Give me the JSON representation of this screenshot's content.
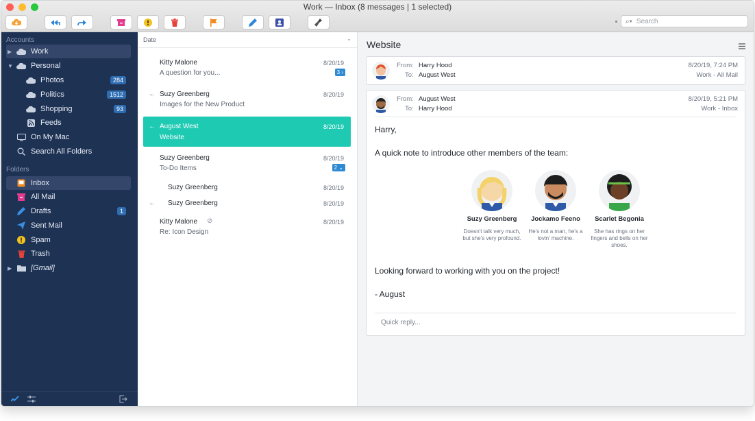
{
  "window": {
    "title": "Work — Inbox (8 messages | 1 selected)"
  },
  "toolbar": {
    "search_placeholder": "Search"
  },
  "sidebar": {
    "accounts_title": "Accounts",
    "folders_title": "Folders",
    "accounts": [
      {
        "label": "Work"
      },
      {
        "label": "Personal"
      },
      {
        "label": "Photos",
        "badge": "284"
      },
      {
        "label": "Politics",
        "badge": "1512"
      },
      {
        "label": "Shopping",
        "badge": "93"
      },
      {
        "label": "Feeds"
      },
      {
        "label": "On My Mac"
      },
      {
        "label": "Search All Folders"
      }
    ],
    "folders": [
      {
        "label": "Inbox"
      },
      {
        "label": "All Mail"
      },
      {
        "label": "Drafts",
        "badge": "1"
      },
      {
        "label": "Sent Mail"
      },
      {
        "label": "Spam"
      },
      {
        "label": "Trash"
      },
      {
        "label": "[Gmail]"
      }
    ]
  },
  "list": {
    "sort_label": "Date",
    "messages": [
      {
        "from": "Kitty Malone",
        "subject": "A question for you...",
        "date": "8/20/19",
        "count": "3"
      },
      {
        "from": "Suzy Greenberg",
        "subject": "Images for the New Product",
        "date": "8/20/19"
      },
      {
        "from": "August West",
        "subject": "Website",
        "date": "8/20/19"
      },
      {
        "from": "Suzy Greenberg",
        "subject": "To-Do Items",
        "date": "8/20/19",
        "count": "2"
      },
      {
        "from": "Suzy Greenberg",
        "date": "8/20/19"
      },
      {
        "from": "Suzy Greenberg",
        "date": "8/20/19"
      },
      {
        "from": "Kitty Malone",
        "subject": "Re: Icon Design",
        "date": "8/20/19"
      }
    ]
  },
  "reader": {
    "title": "Website",
    "first": {
      "from_label": "From:",
      "to_label": "To:",
      "from": "Harry Hood",
      "to": "August West",
      "date": "8/20/19, 7:24 PM",
      "folder": "Work - All Mail"
    },
    "second": {
      "from_label": "From:",
      "to_label": "To:",
      "from": "August West",
      "to": "Harry Hood",
      "date": "8/20/19, 5:21 PM",
      "folder": "Work - Inbox",
      "greeting": "Harry,",
      "intro": "A quick note to introduce other members of the team:",
      "people": [
        {
          "name": "Suzy Greenberg",
          "desc": "Doesn't talk very much, but she's very profound."
        },
        {
          "name": "Jockamo Feeno",
          "desc": "He's not a man, he's a lovin' machine."
        },
        {
          "name": "Scarlet Begonia",
          "desc": "She has rings on her fingers and bells on her shoes."
        }
      ],
      "closing": "Looking forward to working with you on the project!",
      "signature": "- August",
      "quick_reply": "Quick reply..."
    }
  }
}
